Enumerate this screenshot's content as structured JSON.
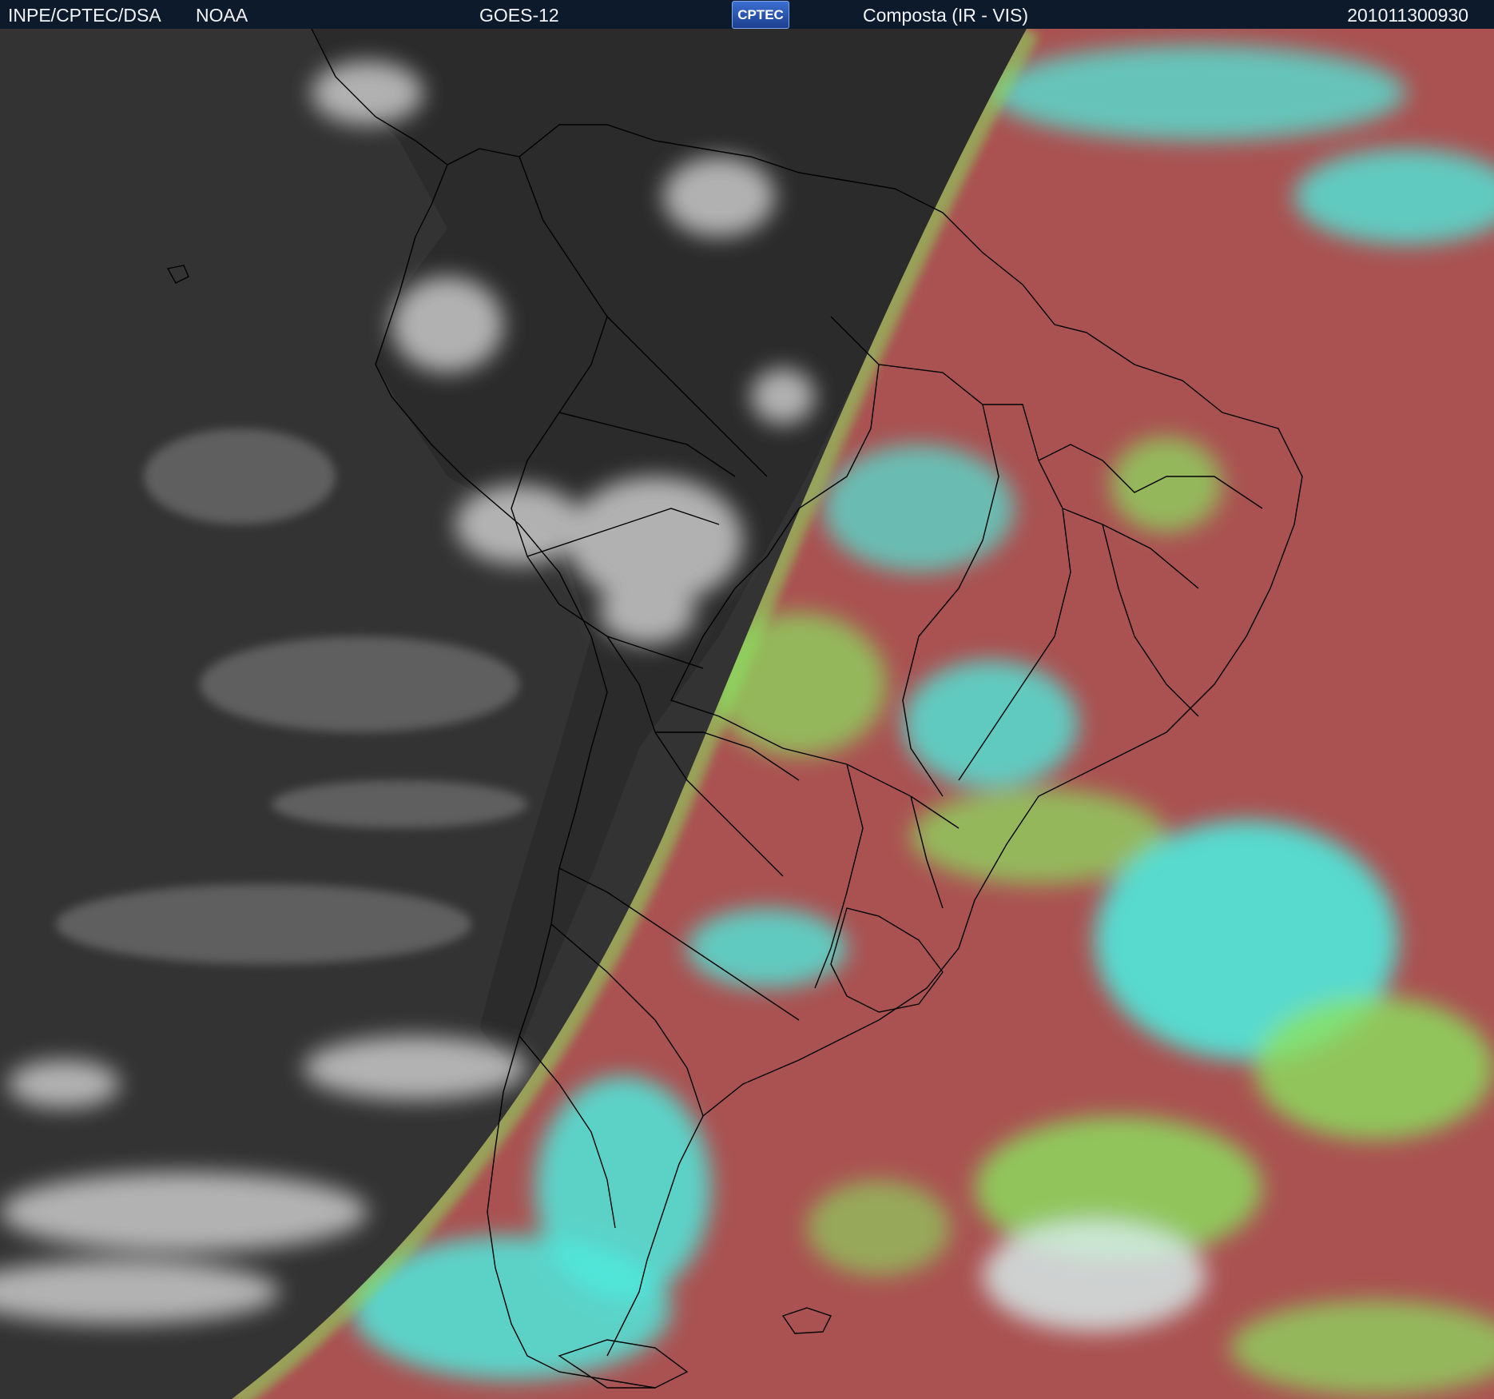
{
  "header": {
    "source_left": "INPE/CPTEC/DSA",
    "source_right": "NOAA",
    "satellite": "GOES-12",
    "logo_text": "CPTEC",
    "product": "Composta (IR - VIS)",
    "timestamp": "201011300930"
  },
  "colors": {
    "header_bg": "#0d1a2c",
    "night_side": "#3a3a3a",
    "day_ocean": "#b8574a",
    "cloud_cyan": "#4fe9dc",
    "cloud_green": "#8be25f",
    "land_magenta": "#8f4a62",
    "border_lines": "#000000"
  },
  "map": {
    "region": "South America",
    "left_side": "infrared (night, grayscale)",
    "right_side": "visible composite (day, false color)"
  }
}
